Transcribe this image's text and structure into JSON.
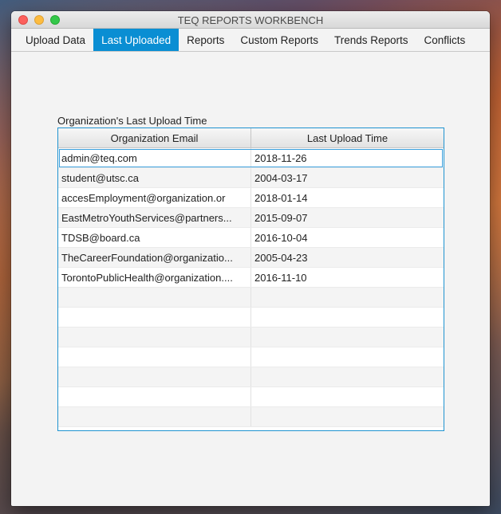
{
  "window": {
    "title": "TEQ REPORTS WORKBENCH"
  },
  "tabs": [
    {
      "label": "Upload Data",
      "active": false
    },
    {
      "label": "Last Uploaded",
      "active": true
    },
    {
      "label": "Reports",
      "active": false
    },
    {
      "label": "Custom Reports",
      "active": false
    },
    {
      "label": "Trends Reports",
      "active": false
    },
    {
      "label": "Conflicts",
      "active": false
    }
  ],
  "colors": {
    "accent": "#0a8ed3",
    "close": "#fc605c",
    "minimize": "#fdbc40",
    "maximize": "#34c84a"
  },
  "table": {
    "caption": "Organization's Last Upload Time",
    "columns": [
      "Organization Email",
      "Last Upload Time"
    ],
    "rows": [
      [
        "admin@teq.com",
        "2018-11-26"
      ],
      [
        "student@utsc.ca",
        "2004-03-17"
      ],
      [
        "accesEmployment@organization.or",
        "2018-01-14"
      ],
      [
        "EastMetroYouthServices@partners...",
        "2015-09-07"
      ],
      [
        "TDSB@board.ca",
        "2016-10-04"
      ],
      [
        "TheCareerFoundation@organizatio...",
        "2005-04-23"
      ],
      [
        "TorontoPublicHealth@organization....",
        "2016-11-10"
      ]
    ],
    "selected_row": 0
  }
}
